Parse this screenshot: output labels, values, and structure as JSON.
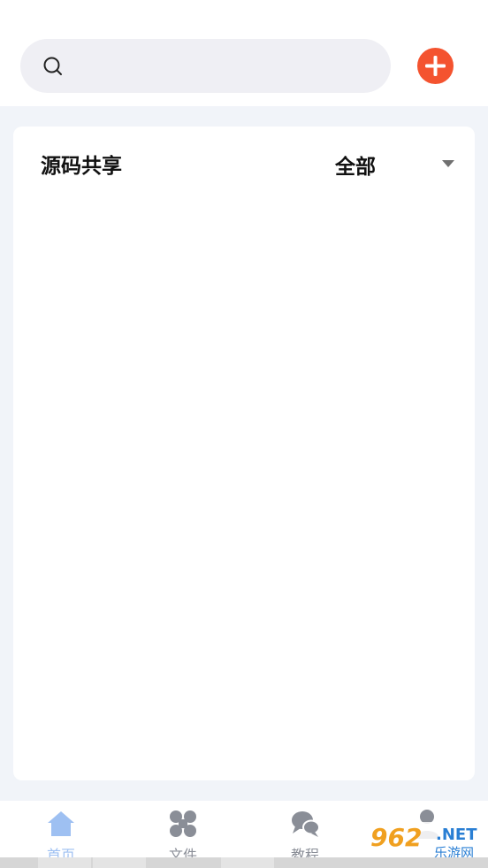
{
  "search": {
    "placeholder": ""
  },
  "list": {
    "title": "源码共享",
    "filter_value": "全部",
    "items": []
  },
  "tabs": [
    {
      "label": "首页",
      "icon": "home-icon",
      "active": true
    },
    {
      "label": "文件",
      "icon": "grid-icon",
      "active": false
    },
    {
      "label": "教程",
      "icon": "chat-icon",
      "active": false
    },
    {
      "label": "",
      "icon": "user-icon",
      "active": false
    }
  ],
  "watermark": {
    "number": "962",
    "net": ".NET",
    "name": "乐游网"
  },
  "colors": {
    "accent": "#f4532f",
    "tab_active": "#9ec0f2",
    "tab_inactive": "#8a8e97",
    "background": "#f1f4f9"
  }
}
